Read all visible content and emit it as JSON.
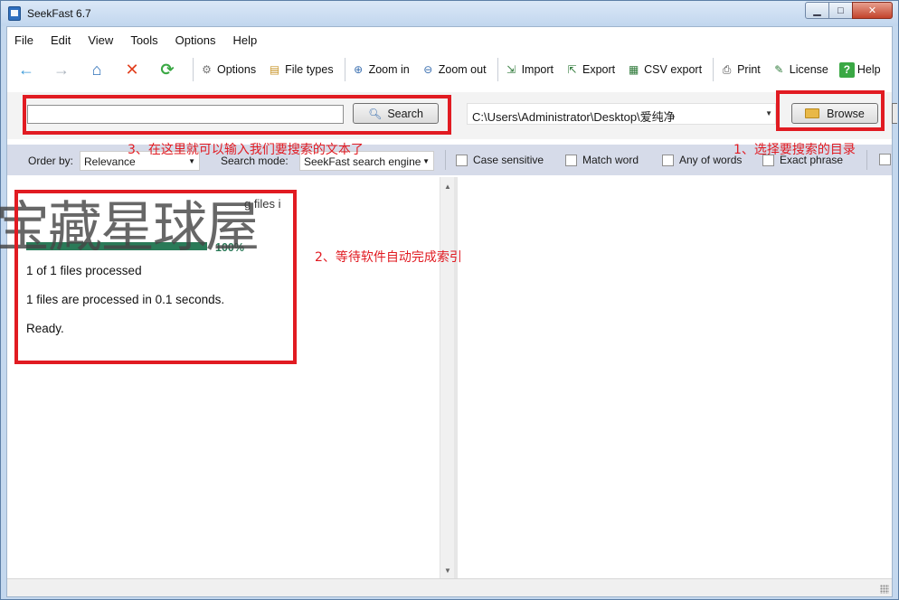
{
  "window": {
    "title": "SeekFast 6.7"
  },
  "menu": [
    "File",
    "Edit",
    "View",
    "Tools",
    "Options",
    "Help"
  ],
  "toolbar": {
    "nav": [
      {
        "name": "back-arrow-icon",
        "glyph": "←",
        "color": "#3a9ad9"
      },
      {
        "name": "forward-arrow-icon",
        "glyph": "→",
        "color": "#aab3bd"
      },
      {
        "name": "home-icon",
        "glyph": "⌂",
        "color": "#2d6fb8"
      },
      {
        "name": "stop-icon",
        "glyph": "✕",
        "color": "#e2401f"
      },
      {
        "name": "refresh-icon",
        "glyph": "⟳",
        "color": "#3aa844"
      }
    ],
    "buttons": [
      {
        "label": "Options",
        "icon": "gear-icon",
        "glyph": "⚙"
      },
      {
        "label": "File types",
        "icon": "file-types-icon",
        "glyph": "▤"
      },
      {
        "label": "Zoom in",
        "icon": "zoom-in-icon",
        "glyph": "⊕"
      },
      {
        "label": "Zoom out",
        "icon": "zoom-out-icon",
        "glyph": "⊖"
      },
      {
        "label": "Import",
        "icon": "import-icon",
        "glyph": "⇲"
      },
      {
        "label": "Export",
        "icon": "export-icon",
        "glyph": "⇱"
      },
      {
        "label": "CSV export",
        "icon": "csv-export-icon",
        "glyph": "▦"
      },
      {
        "label": "Print",
        "icon": "print-icon",
        "glyph": "⎙"
      },
      {
        "label": "License",
        "icon": "license-icon",
        "glyph": "✎"
      },
      {
        "label": "Help",
        "icon": "help-icon",
        "glyph": "?"
      }
    ]
  },
  "search": {
    "query": "",
    "button_label": "Search",
    "path": "C:\\Users\\Administrator\\Desktop\\爱纯净",
    "browse_label": "Browse"
  },
  "options": {
    "order_by_label": "Order by:",
    "order_by_value": "Relevance",
    "search_mode_label": "Search mode:",
    "search_mode_value": "SeekFast search engine",
    "checkboxes": [
      "Case sensitive",
      "Match word",
      "Any of words",
      "Exact phrase"
    ]
  },
  "progress": {
    "title_fragment": "g files i",
    "fraction": 1.0,
    "percent_label": "100%",
    "lines": [
      "1 of 1 files processed",
      "1 files are processed in 0.1 seconds.",
      "Ready."
    ]
  },
  "annotations": {
    "step1": "1、选择要搜索的目录",
    "step2": "2、等待软件自动完成索引",
    "step3": "3、在这里就可以输入我们要搜索的文本了",
    "color": "#e11b22"
  },
  "watermark": "宝藏星球屋"
}
